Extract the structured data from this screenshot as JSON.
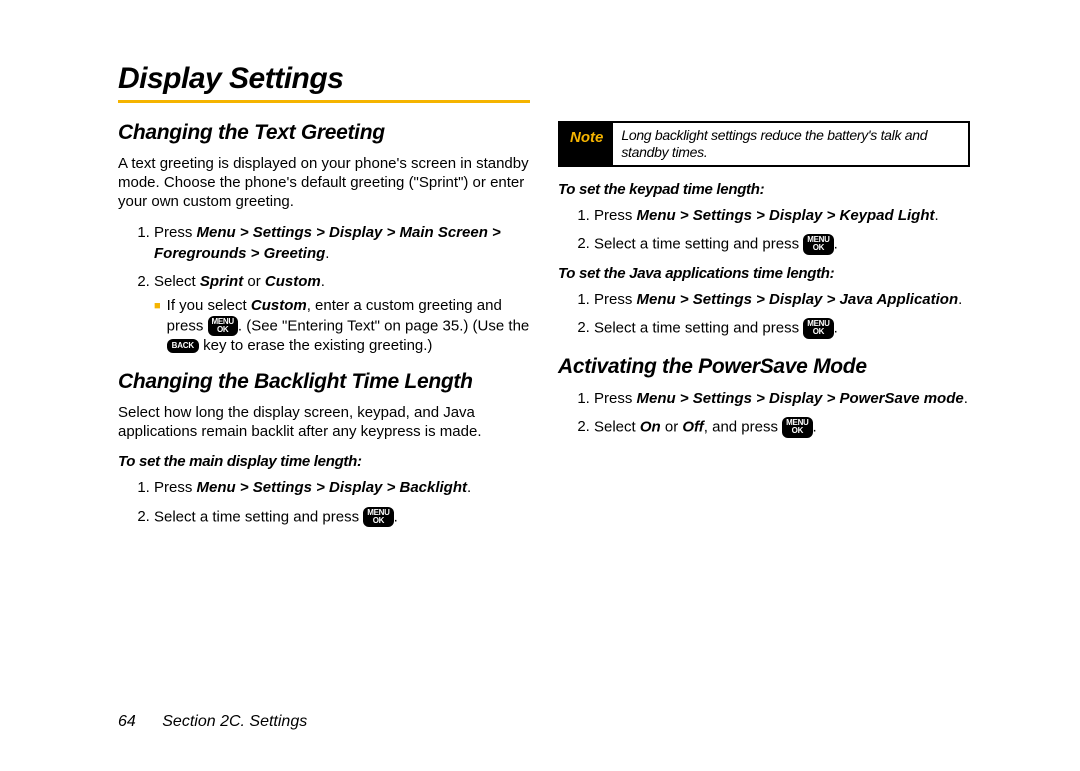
{
  "page_title": "Display Settings",
  "left": {
    "h_greeting": "Changing the Text Greeting",
    "greeting_body": "A text greeting is displayed on your phone's screen in standby mode. Choose the phone's default greeting (\"Sprint\") or enter your own custom greeting.",
    "greet_step1_pre": "Press ",
    "greet_step1_path": "Menu > Settings > Display > Main Screen > Foregrounds > Greeting",
    "greet_step2_pre": "Select ",
    "greet_step2_opt1": "Sprint",
    "greet_step2_or": " or ",
    "greet_step2_opt2": "Custom",
    "greet_sub_pre": "If you select ",
    "greet_sub_custom": "Custom",
    "greet_sub_mid1": ", enter a custom greeting and press ",
    "greet_sub_mid2": ". (See \"Entering Text\" on page 35.) (Use the ",
    "greet_sub_end": " key to erase the existing greeting.)",
    "h_backlight": "Changing the Backlight Time Length",
    "backlight_body": "Select how long the display screen, keypad, and Java applications remain backlit after any keypress is made.",
    "sub_main_display": "To set the main display time length:",
    "bl_step1_pre": "Press ",
    "bl_step1_path": "Menu > Settings > Display > Backlight",
    "bl_step2_pre": "Select a time setting and press "
  },
  "right": {
    "note_label": "Note",
    "note_text": "Long backlight settings reduce the battery's talk and standby times.",
    "sub_keypad": "To set the keypad time length:",
    "kp_step1_pre": "Press ",
    "kp_step1_path": "Menu > Settings > Display > Keypad Light",
    "kp_step2_pre": "Select a time setting and press ",
    "sub_java": "To set the Java applications time length:",
    "jv_step1_pre": "Press ",
    "jv_step1_path": "Menu > Settings > Display > Java Application",
    "jv_step2_pre": "Select a time setting and press ",
    "h_powersave": "Activating the PowerSave Mode",
    "ps_step1_pre": "Press ",
    "ps_step1_path": "Menu > Settings > Display > PowerSave mode",
    "ps_step2_pre": "Select ",
    "ps_step2_on": "On",
    "ps_step2_or": " or ",
    "ps_step2_off": "Off",
    "ps_step2_mid": ", and press "
  },
  "keys": {
    "menu": "MENU",
    "ok": "OK",
    "back": "BACK"
  },
  "footer": {
    "page_num": "64",
    "section": "Section 2C. Settings"
  }
}
